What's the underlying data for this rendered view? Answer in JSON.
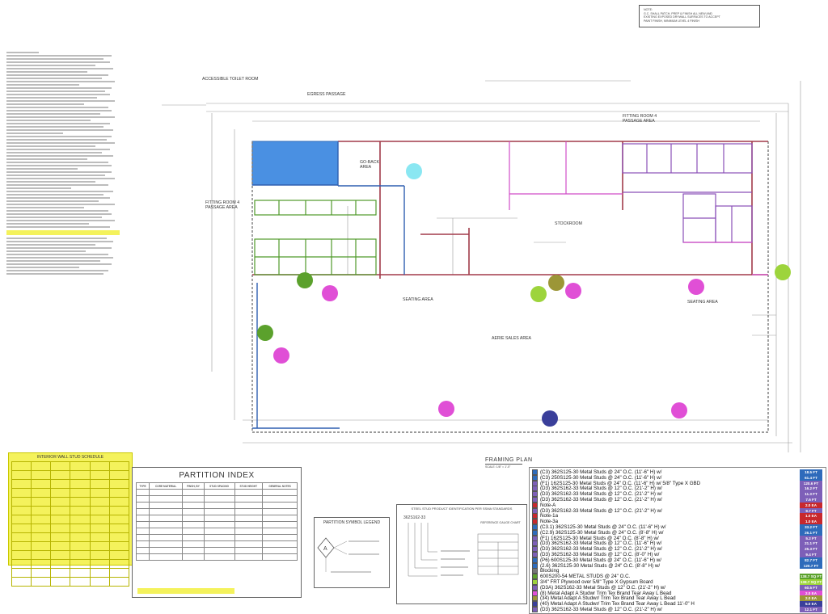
{
  "note": {
    "title": "NOTE:",
    "lines": [
      "G.C. SHALL PATCH, PREP & FINISH ALL NEW AND",
      "EXISTING EXPOSED DRYWALL SURFACES TO ACCEPT",
      "PAINT FINISH, MINIMUM LEVEL 4 FINISH"
    ]
  },
  "plan": {
    "rooms": {
      "accessible_toilet": "ACCESSIBLE TOILET ROOM",
      "egress_passage": "EGRESS PASSAGE",
      "fitting_room_4": "FITTING ROOM 4",
      "fitting_room_4_b": "PASSAGE AREA",
      "go_back": "GO-BACK",
      "go_back_b": "AREA",
      "fitting_room_passage": "FITTING ROOM 4",
      "fitting_room_passage_b": "PASSAGE AREA",
      "stockroom": "STOCKROOM",
      "seating_left": "SEATING AREA",
      "seating_right": "SEATING AREA",
      "sales_area": "AERIE SALES AREA"
    }
  },
  "partition_index": {
    "title": "PARTITION INDEX",
    "headers": [
      "TYPE",
      "CORE MATERIAL",
      "FINSH, BY",
      "STUD SPACING",
      "STUD HEIGHT",
      "GENERAL NOTES"
    ]
  },
  "yellow_table": {
    "title": "INTERIOR WALL STUD SCHEDULE"
  },
  "symbol_legend": {
    "title": "PARTITION SYMBOL LEGEND"
  },
  "steel_stud": {
    "title": "STEEL STUD PRODUCT IDENTIFICATION PER SSMA STANDARDS",
    "code": "362S162-33",
    "sub": "REFERENCE GAUGE CHART"
  },
  "framing_plan": {
    "title": "FRAMING PLAN",
    "scale": "SCALE: 1/8\" = 1'-0\""
  },
  "legend_colors": {
    "box_blue": "#4a90e2",
    "cyan": "#8ae7f2",
    "green": "#5ba12c",
    "lime": "#9dd43c",
    "magenta": "#e04fd6",
    "olive": "#9c9637",
    "navy": "#3a3f9a"
  },
  "legend": [
    {
      "label": "(C3) 362S125-30 Metal Studs @ 24\" O.C. (11'-6\" H) w/",
      "value": "18.5 FT",
      "color": "#2e6bbb"
    },
    {
      "label": "(C3) 250S125-30 Metal Studs @ 24\" O.C. (11'-6\" H) w/",
      "value": "61.4 FT",
      "color": "#2e6bbb"
    },
    {
      "label": "(F1) 162S125-30 Metal Studs @ 24\" O.C. (11'-6\" H) w/ 5/8\" Type X GBD",
      "value": "120.6 FT",
      "color": "#7d5fb8"
    },
    {
      "label": "(D3) 362S162-33 Metal Studs @ 12\" O.C. (21'-2\" H) w/",
      "value": "16.2 FT",
      "color": "#7d5fb8"
    },
    {
      "label": "(D3) 362S162-33 Metal Studs @ 12\" O.C. (21'-2\" H) w/",
      "value": "11.3 FT",
      "color": "#7d5fb8"
    },
    {
      "label": "(D3) 362S162-33 Metal Studs @ 12\" O.C. (21'-2\" H) w/",
      "value": "7.6 FT",
      "color": "#7d5fb8"
    },
    {
      "label": "Note-A",
      "value": "2.0 EA",
      "color": "#c8282d"
    },
    {
      "label": "(D3) 362S162-33 Metal Studs @ 12\" O.C. (21'-2\" H) w/",
      "value": "9.7 FT",
      "color": "#7d5fb8"
    },
    {
      "label": "Note-1a",
      "value": "1.0 EA",
      "color": "#c8282d"
    },
    {
      "label": "Note-3a",
      "value": "1.0 EA",
      "color": "#c8282d"
    },
    {
      "label": "(C3.1) 362S125-30 Metal Studs @ 24\" O.C. (11'-6\" H) w/",
      "value": "33.2 FT",
      "color": "#2e6bbb"
    },
    {
      "label": "(C2.9) 362S125-30 Metal Studs @ 24\" O.C. (8'-8\" H) w/",
      "value": "26.1 FT",
      "color": "#2e6bbb"
    },
    {
      "label": "(F1) 162S125-30 Metal Studs @ 24\" O.C. (8'-8\" H) w/",
      "value": "5.2 FT",
      "color": "#7d5fb8"
    },
    {
      "label": "(D3) 362S162-33 Metal Studs @ 12\" O.C. (11'-6\" H) w/",
      "value": "21.1 FT",
      "color": "#7d5fb8"
    },
    {
      "label": "(D3) 362S162-33 Metal Studs @ 12\" O.C. (21'-2\" H) w/",
      "value": "25.3 FT",
      "color": "#7d5fb8"
    },
    {
      "label": "(D3) 362S162-33 Metal Studs @ 12\" O.C. (8'-0\" H) w/",
      "value": "9.4 FT",
      "color": "#7d5fb8"
    },
    {
      "label": "(P6) 600S125-30 Metal Studs @ 24\" O.C. (11'-6\" H) w/",
      "value": "82.7 FT",
      "color": "#2e6bbb"
    },
    {
      "label": "(2.6) 362S125-30 Metal Studs @ 24\" O.C. (8'-8\" H) w/",
      "value": "120.7 FT",
      "color": "#2e6bbb"
    },
    {
      "label": "Blocking",
      "value": "",
      "color": "#777777"
    },
    {
      "label": "600S200-54 METAL STUDS @ 24\" O.C.",
      "value": "138.7 SQ FT",
      "color": "#5ba12c"
    },
    {
      "label": "3/4\" FRT Plywood over 5/8\" Type X Gypsum Board",
      "value": "138.7 SQ FT",
      "color": "#9dd43c"
    },
    {
      "label": "(D3A) 362S162-33 Metal Studs @ 12\" O.C. (21'-2\" H) w/",
      "value": "60.5 FT",
      "color": "#7d5fb8"
    },
    {
      "label": "(8) Metal Adapt A Studwr Trim Tex Brand  Tear Away L Bead",
      "value": "2.0 EA",
      "color": "#e04fd6"
    },
    {
      "label": "(34) Metal Adapt A Studwr/ Trim Tex Brand  Tear Away L Bead",
      "value": "2.0 EA",
      "color": "#9c9637"
    },
    {
      "label": "(40) Metal Adapt A Studwr/ Trim Tex Brand  Tear Away L Bead 11'-0\" H",
      "value": "5.0 EA",
      "color": "#3a3f9a"
    },
    {
      "label": "(D3) 362S162-33 Metal Studs @ 12\" O.C. (21'-2\" H) w/",
      "value": "12.1 FT",
      "color": "#7d5fb8"
    }
  ]
}
